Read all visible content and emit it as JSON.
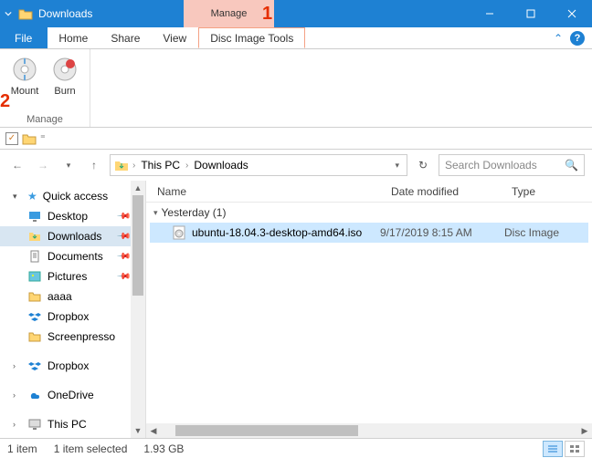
{
  "window": {
    "title": "Downloads"
  },
  "contextual_tab": {
    "label": "Manage"
  },
  "annotations": {
    "one": "1",
    "two": "2"
  },
  "tabs": {
    "file": "File",
    "home": "Home",
    "share": "Share",
    "view": "View",
    "disc_image_tools": "Disc Image Tools"
  },
  "ribbon": {
    "mount": "Mount",
    "burn": "Burn",
    "group_label": "Manage"
  },
  "address": {
    "this_pc": "This PC",
    "downloads": "Downloads"
  },
  "search": {
    "placeholder": "Search Downloads"
  },
  "columns": {
    "name": "Name",
    "date": "Date modified",
    "type": "Type"
  },
  "group": {
    "label": "Yesterday (1)"
  },
  "file": {
    "name": "ubuntu-18.04.3-desktop-amd64.iso",
    "date": "9/17/2019 8:15 AM",
    "type": "Disc Image"
  },
  "sidebar": {
    "quick_access": "Quick access",
    "desktop": "Desktop",
    "downloads": "Downloads",
    "documents": "Documents",
    "pictures": "Pictures",
    "aaaa": "aaaa",
    "dropbox_pin": "Dropbox",
    "screenpresso": "Screenpresso",
    "dropbox": "Dropbox",
    "onedrive": "OneDrive",
    "this_pc": "This PC"
  },
  "status": {
    "count": "1 item",
    "selected": "1 item selected",
    "size": "1.93 GB"
  }
}
